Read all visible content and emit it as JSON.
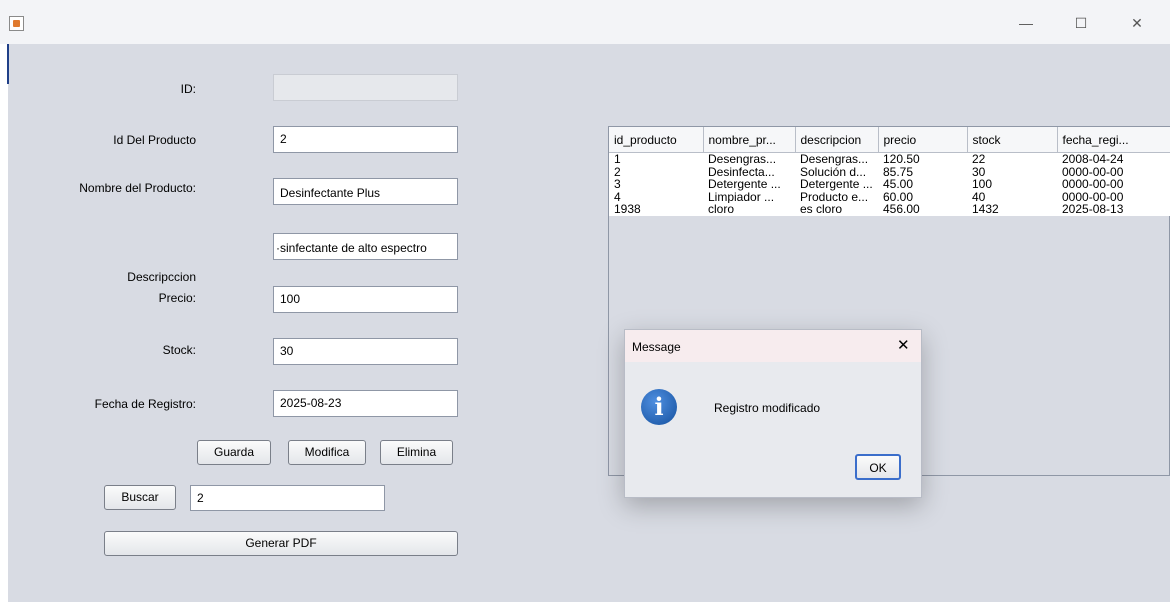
{
  "window": {
    "minimize": "—",
    "maximize": "☐",
    "close": "✕"
  },
  "form": {
    "id_label": "ID:",
    "id_value": "",
    "product_id_label": "Id Del Producto",
    "product_id_value": "2",
    "name_label": "Nombre del Producto:",
    "name_value": "Desinfectante Plus",
    "description_label": "Descripccion",
    "description_value": "·sinfectante de alto espectro",
    "price_label": "Precio:",
    "price_value": "100",
    "stock_label": "Stock:",
    "stock_value": "30",
    "date_label": "Fecha de Registro:",
    "date_value": "2025-08-23"
  },
  "buttons": {
    "save": "Guarda",
    "modify": "Modifica",
    "delete": "Elimina",
    "search": "Buscar",
    "pdf": "Generar PDF"
  },
  "search": {
    "value": "2"
  },
  "table": {
    "headers": [
      "id_producto",
      "nombre_pr...",
      "descripcion",
      "precio",
      "stock",
      "fecha_regi..."
    ],
    "rows": [
      [
        "1",
        "Desengras...",
        "Desengras...",
        "120.50",
        "22",
        "2008-04-24"
      ],
      [
        "2",
        "Desinfecta...",
        "Solución d...",
        "85.75",
        "30",
        "0000-00-00"
      ],
      [
        "3",
        "Detergente ...",
        "Detergente ...",
        "45.00",
        "100",
        "0000-00-00"
      ],
      [
        "4",
        "Limpiador ...",
        "Producto e...",
        "60.00",
        "40",
        "0000-00-00"
      ],
      [
        "1938",
        "cloro",
        "es cloro",
        "456.00",
        "1432",
        "2025-08-13"
      ]
    ]
  },
  "dialog": {
    "title": "Message",
    "close": "✕",
    "icon": "i",
    "message": "Registro modificado",
    "ok": "OK"
  }
}
